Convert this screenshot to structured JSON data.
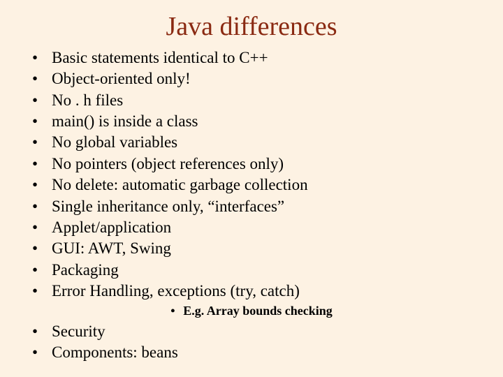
{
  "title": "Java differences",
  "bullets_top": [
    "Basic statements identical to C++",
    "Object-oriented only!",
    "No . h files",
    "main() is inside a class",
    "No global variables",
    "No pointers (object references only)",
    "No delete:  automatic garbage collection",
    "Single inheritance only,  “interfaces”",
    "Applet/application",
    "GUI:  AWT, Swing",
    "Packaging",
    "Error Handling, exceptions (try, catch)"
  ],
  "sub_bullets": [
    "E.g. Array bounds checking"
  ],
  "bullets_bottom": [
    "Security",
    "Components:  beans"
  ]
}
